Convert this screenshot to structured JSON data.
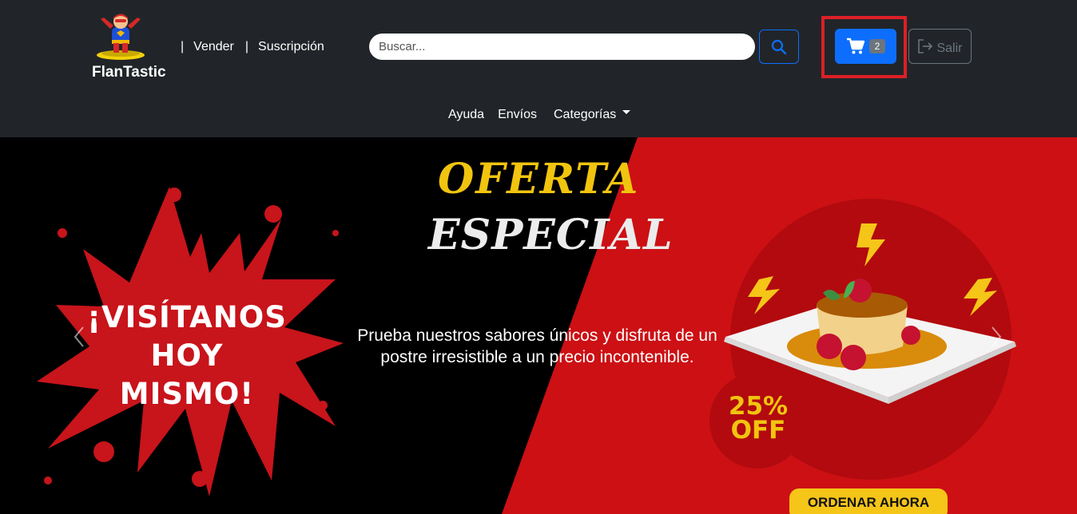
{
  "brand": {
    "name": "FlanTastic"
  },
  "nav": {
    "separator": "|",
    "vender": "Vender",
    "suscripcion": "Suscripción",
    "ayuda": "Ayuda",
    "envios": "Envíos",
    "categorias": "Categorías"
  },
  "search": {
    "placeholder": "Buscar...",
    "value": ""
  },
  "cart": {
    "count": "2"
  },
  "logout": {
    "label": "Salir"
  },
  "banner": {
    "splash_line1": "¡VISÍTANOS",
    "splash_line2": "HOY MISMO!",
    "title_line1": "OFERTA",
    "title_line2": "ESPECIAL",
    "promo_text": "Prueba nuestros sabores únicos y disfruta de un postre irresistible a un precio incontenible.",
    "discount_line1": "25%",
    "discount_line2": "OFF",
    "cta": "ORDENAR AHORA"
  },
  "colors": {
    "navbar": "#212529",
    "primary": "#0d6efd",
    "banner_red": "#cc1014",
    "accent_yellow": "#f1c40f",
    "highlight": "#dc1f26"
  },
  "icons": {
    "search": "search-icon",
    "cart": "cart-icon",
    "logout": "logout-icon",
    "prev": "chevron-left-icon",
    "next": "chevron-right-icon"
  }
}
